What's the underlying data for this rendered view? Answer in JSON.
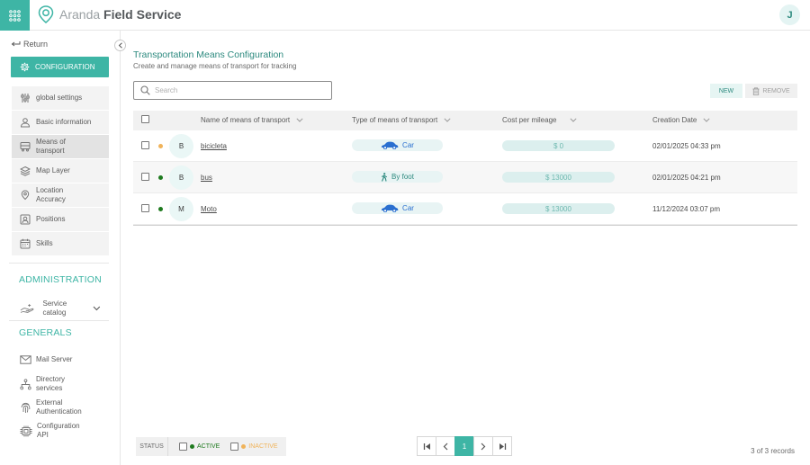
{
  "app": {
    "brand_light": "Aranda",
    "brand_bold": "Field Service",
    "user_initial": "J"
  },
  "sidebar": {
    "return_label": "Return",
    "config_label": "CONFIGURATION",
    "config_items": [
      {
        "label": "global settings",
        "icon": "sliders-icon"
      },
      {
        "label": "Basic information",
        "icon": "user-info-icon"
      },
      {
        "label": "Means of transport",
        "icon": "transport-icon",
        "active": true
      },
      {
        "label": "Map Layer",
        "icon": "layers-icon"
      },
      {
        "label": "Location Accuracy",
        "icon": "location-icon"
      },
      {
        "label": "Positions",
        "icon": "positions-icon"
      },
      {
        "label": "Skills",
        "icon": "calendar-icon"
      }
    ],
    "administration_title": "ADMINISTRATION",
    "service_catalog_label": "Service catalog",
    "generals_title": "GENERALS",
    "generals_items": [
      {
        "label": "Mail Server",
        "icon": "mail-icon"
      },
      {
        "label": "Directory services",
        "icon": "directory-icon"
      },
      {
        "label": "External Authentication",
        "icon": "fingerprint-icon"
      },
      {
        "label": "Configuration API",
        "icon": "chip-icon"
      }
    ]
  },
  "page": {
    "title": "Transportation Means Configuration",
    "subtitle": "Create and manage means of transport for tracking",
    "search_placeholder": "Search",
    "new_label": "NEW",
    "remove_label": "REMOVE"
  },
  "table": {
    "columns": [
      "Name of means of transport",
      "Type of means of transport",
      "Cost per mileage",
      "Creation Date"
    ],
    "rows": [
      {
        "status": "inactive",
        "initial": "B",
        "name": "bicicleta",
        "type": "Car",
        "type_icon": "car-icon",
        "cost": "$ 0",
        "date": "02/01/2025 04:33 pm"
      },
      {
        "status": "active",
        "initial": "B",
        "name": "bus",
        "type": "By foot",
        "type_icon": "walking-icon",
        "cost": "$ 13000",
        "date": "02/01/2025 04:21 pm"
      },
      {
        "status": "active",
        "initial": "M",
        "name": "Moto",
        "type": "Car",
        "type_icon": "car-icon",
        "cost": "$ 13000",
        "date": "11/12/2024 03:07 pm"
      }
    ]
  },
  "footer": {
    "status_label": "STATUS",
    "active_label": "ACTIVE",
    "inactive_label": "INACTIVE",
    "current_page": "1",
    "records_text": "3 of 3 records"
  },
  "colors": {
    "accent": "#3eb5a5",
    "active_dot": "#1e7a1e",
    "inactive_dot": "#f0b35a",
    "car_blue": "#2a6fd0"
  }
}
